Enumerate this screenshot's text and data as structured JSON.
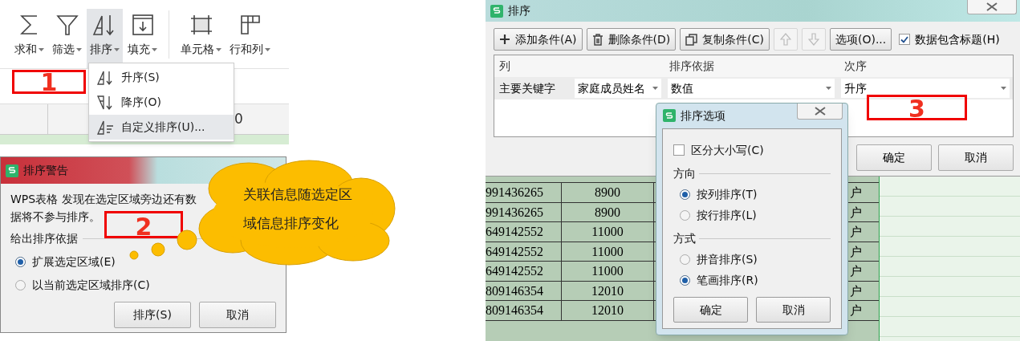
{
  "toolbar": {
    "buttons": [
      {
        "kind": "sum",
        "label": "求和",
        "selected": false
      },
      {
        "kind": "filter",
        "label": "筛选",
        "selected": false
      },
      {
        "kind": "sort",
        "label": "排序",
        "selected": true
      },
      {
        "kind": "fill",
        "label": "填充",
        "selected": false
      },
      {
        "kind": "cell",
        "label": "单元格",
        "selected": false
      },
      {
        "kind": "rowcol",
        "label": "行和列",
        "selected": false
      }
    ]
  },
  "sheet_left": {
    "cell": "0"
  },
  "sort_menu": {
    "items": [
      {
        "kind": "asc",
        "label": "升序(S)",
        "selected": false
      },
      {
        "kind": "desc",
        "label": "降序(O)",
        "selected": false
      },
      {
        "kind": "custom",
        "label": "自定义排序(U)...",
        "selected": true
      }
    ]
  },
  "annotations": [
    "1",
    "2",
    "3"
  ],
  "warning_dialog": {
    "title": "排序警告",
    "message_line_1": "WPS表格 发现在选定区域旁边还有数",
    "message_line_2": "据将不参与排序。",
    "group": "给出排序依据",
    "options": [
      {
        "label": "扩展选定区域(E)",
        "selected": true
      },
      {
        "label": "以当前选定区域排序(C)",
        "selected": false
      }
    ],
    "buttons": [
      "排序(S)",
      "取消"
    ]
  },
  "callout": {
    "lines": [
      "关联信息随选定区",
      "域信息排序变化"
    ]
  },
  "sort_dialog": {
    "title": "排序",
    "toolbar": [
      {
        "kind": "add",
        "label": "添加条件(A)",
        "disabled": false
      },
      {
        "kind": "delete",
        "label": "删除条件(D)",
        "disabled": false
      },
      {
        "kind": "copy",
        "label": "复制条件(C)",
        "disabled": false
      },
      {
        "kind": "up",
        "disabled": true
      },
      {
        "kind": "down",
        "disabled": true
      },
      {
        "kind": "text",
        "label": "选项(O)...",
        "disabled": false
      }
    ],
    "header_checkbox": {
      "label": "数据包含标题(H)",
      "checked": true
    },
    "columns": [
      "列",
      "排序依据",
      "次序"
    ],
    "row": {
      "label": "主要关键字",
      "column": "家庭成员姓名",
      "basis": "数值",
      "order": "升序"
    },
    "buttons": [
      "确定",
      "取消"
    ]
  },
  "sheet_right": {
    "rows": [
      {
        "column_1": "991436265",
        "column_2": "8900",
        "column_3": "户"
      },
      {
        "column_1": "991436265",
        "column_2": "8900",
        "column_3": "户"
      },
      {
        "column_1": "649142552",
        "column_2": "11000",
        "column_3": "户"
      },
      {
        "column_1": "649142552",
        "column_2": "11000",
        "column_3": "户"
      },
      {
        "column_1": "649142552",
        "column_2": "11000",
        "column_3": "户"
      },
      {
        "column_1": "809146354",
        "column_2": "12010",
        "column_3": "户"
      },
      {
        "column_1": "809146354",
        "column_2": "12010",
        "column_3": "户"
      }
    ]
  },
  "options_dialog": {
    "title": "排序选项",
    "case_checkbox": {
      "label": "区分大小写(C)",
      "checked": false
    },
    "groups": [
      {
        "title": "方向",
        "options": [
          {
            "label": "按列排序(T)",
            "selected": true
          },
          {
            "label": "按行排序(L)",
            "selected": false
          }
        ]
      },
      {
        "title": "方式",
        "options": [
          {
            "label": "拼音排序(S)",
            "selected": false
          },
          {
            "label": "笔画排序(R)",
            "selected": true
          }
        ]
      }
    ],
    "buttons": [
      "确定",
      "取消"
    ]
  }
}
